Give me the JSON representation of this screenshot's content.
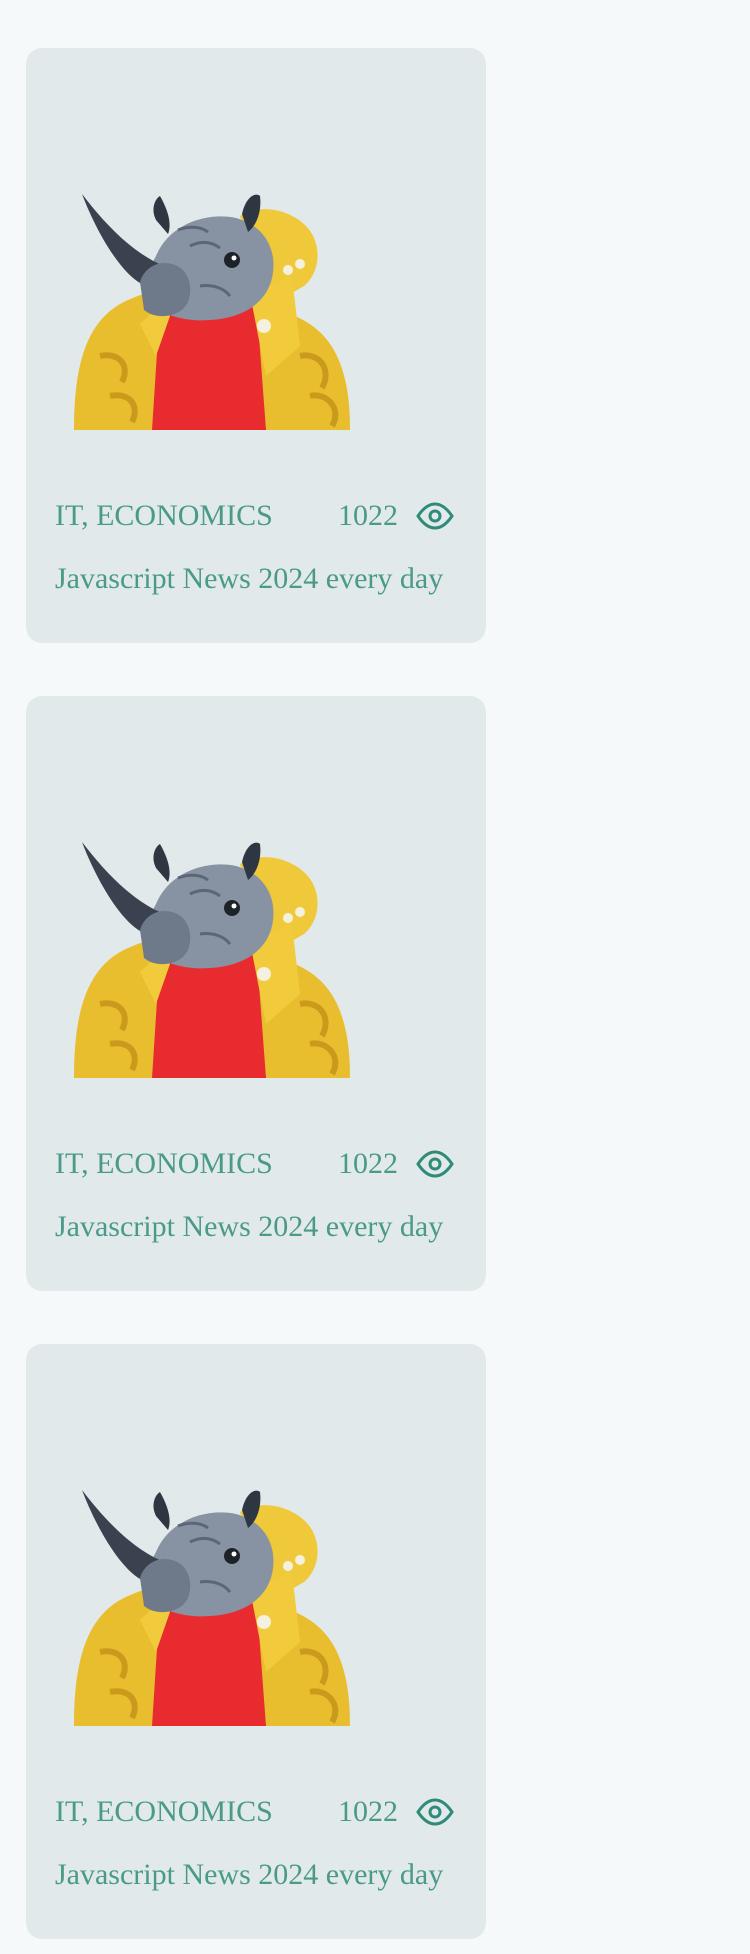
{
  "theme": {
    "page_background": "#f6f9fa",
    "card_background": "#e2e9eb",
    "accent": "#4a9a8a"
  },
  "cards": [
    {
      "image": "rhino-in-yellow-jacket",
      "category": "IT, ECONOMICS",
      "views": "1022",
      "views_icon": "eye-icon",
      "title": "Javascript News 2024 every day"
    },
    {
      "image": "rhino-in-yellow-jacket",
      "category": "IT, ECONOMICS",
      "views": "1022",
      "views_icon": "eye-icon",
      "title": "Javascript News 2024 every day"
    },
    {
      "image": "rhino-in-yellow-jacket",
      "category": "IT, ECONOMICS",
      "views": "1022",
      "views_icon": "eye-icon",
      "title": "Javascript News 2024 every day"
    }
  ]
}
